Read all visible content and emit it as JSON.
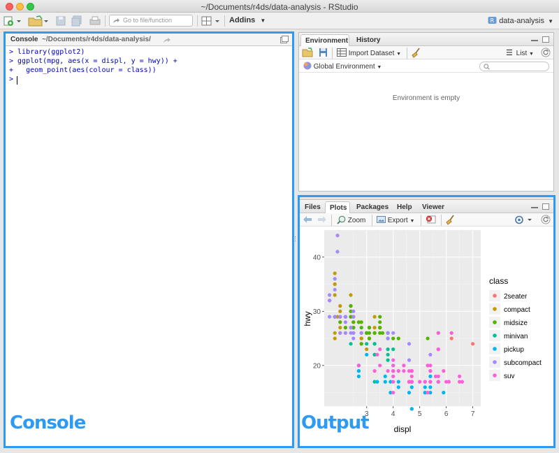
{
  "window": {
    "title": "~/Documents/r4ds/data-analysis - RStudio"
  },
  "toolbar": {
    "goto_placeholder": "Go to file/function",
    "addins_label": "Addins",
    "project_label": "data-analysis"
  },
  "console": {
    "tab_label": "Console",
    "path": "~/Documents/r4ds/data-analysis/",
    "lines": [
      "> library(ggplot2)",
      "> ggplot(mpg, aes(x = displ, y = hwy)) +",
      "+   geom_point(aes(colour = class))",
      ">"
    ],
    "overlay_label": "Console"
  },
  "environment": {
    "tabs": [
      "Environment",
      "History"
    ],
    "import_label": "Import Dataset",
    "list_label": "List",
    "scope_label": "Global Environment",
    "empty_text": "Environment is empty"
  },
  "output": {
    "tabs": [
      "Files",
      "Plots",
      "Packages",
      "Help",
      "Viewer"
    ],
    "zoom_label": "Zoom",
    "export_label": "Export",
    "overlay_label": "Output"
  },
  "colors": {
    "accent": "#2f9af2",
    "code": "#0000c0"
  },
  "chart_data": {
    "type": "scatter",
    "xlabel": "displ",
    "ylabel": "hwy",
    "x_ticks": [
      3,
      4,
      5,
      6,
      7
    ],
    "y_ticks": [
      20,
      30,
      40
    ],
    "xlim": [
      1.4,
      7.3
    ],
    "ylim": [
      12.5,
      45
    ],
    "grid": true,
    "legend": {
      "title": "class",
      "position": "right",
      "entries": [
        {
          "name": "2seater",
          "color": "#f8766d"
        },
        {
          "name": "compact",
          "color": "#c49a00"
        },
        {
          "name": "midsize",
          "color": "#53b400"
        },
        {
          "name": "minivan",
          "color": "#00c094"
        },
        {
          "name": "pickup",
          "color": "#00b6eb"
        },
        {
          "name": "subcompact",
          "color": "#a58aff"
        },
        {
          "name": "suv",
          "color": "#fb61d7"
        }
      ]
    },
    "series": [
      {
        "name": "2seater",
        "points": [
          [
            5.7,
            26
          ],
          [
            5.7,
            23
          ],
          [
            6.2,
            26
          ],
          [
            6.2,
            25
          ],
          [
            7.0,
            24
          ]
        ]
      },
      {
        "name": "compact",
        "points": [
          [
            1.8,
            29
          ],
          [
            1.8,
            29
          ],
          [
            2.0,
            31
          ],
          [
            2.0,
            30
          ],
          [
            2.8,
            26
          ],
          [
            2.8,
            26
          ],
          [
            3.1,
            27
          ],
          [
            1.8,
            26
          ],
          [
            1.8,
            25
          ],
          [
            2.0,
            28
          ],
          [
            2.0,
            27
          ],
          [
            2.8,
            25
          ],
          [
            2.8,
            25
          ],
          [
            3.1,
            25
          ],
          [
            3.1,
            25
          ],
          [
            2.2,
            26
          ],
          [
            2.2,
            27
          ],
          [
            2.4,
            30
          ],
          [
            2.4,
            33
          ],
          [
            3.0,
            26
          ],
          [
            3.3,
            27
          ],
          [
            1.8,
            33
          ],
          [
            1.8,
            35
          ],
          [
            1.8,
            37
          ],
          [
            1.8,
            35
          ],
          [
            1.9,
            44
          ],
          [
            2.0,
            29
          ],
          [
            2.0,
            26
          ],
          [
            2.5,
            29
          ],
          [
            2.5,
            29
          ],
          [
            2.8,
            24
          ],
          [
            2.8,
            24
          ],
          [
            1.9,
            29
          ],
          [
            2.0,
            29
          ],
          [
            2.5,
            28
          ],
          [
            2.5,
            28
          ],
          [
            2.0,
            29
          ],
          [
            2.2,
            29
          ],
          [
            2.2,
            29
          ],
          [
            2.7,
            28
          ],
          [
            3.0,
            23
          ],
          [
            2.4,
            31
          ],
          [
            3.3,
            29
          ]
        ]
      },
      {
        "name": "midsize",
        "points": [
          [
            2.4,
            27
          ],
          [
            2.4,
            30
          ],
          [
            3.1,
            26
          ],
          [
            3.5,
            29
          ],
          [
            3.6,
            26
          ],
          [
            2.2,
            29
          ],
          [
            2.2,
            27
          ],
          [
            2.4,
            31
          ],
          [
            2.4,
            31
          ],
          [
            3.0,
            26
          ],
          [
            3.0,
            26
          ],
          [
            3.5,
            28
          ],
          [
            2.5,
            27
          ],
          [
            2.5,
            27
          ],
          [
            3.3,
            26
          ],
          [
            3.8,
            26
          ],
          [
            3.8,
            26
          ],
          [
            3.8,
            26
          ],
          [
            5.3,
            25
          ],
          [
            2.5,
            27
          ],
          [
            2.7,
            28
          ],
          [
            2.8,
            24
          ],
          [
            3.1,
            27
          ],
          [
            4.2,
            25
          ],
          [
            2.8,
            27
          ],
          [
            3.0,
            26
          ],
          [
            2.4,
            29
          ],
          [
            2.4,
            29
          ],
          [
            3.3,
            26
          ],
          [
            3.3,
            26
          ],
          [
            3.5,
            27
          ],
          [
            3.5,
            27
          ],
          [
            2.5,
            27
          ],
          [
            2.5,
            28
          ],
          [
            3.5,
            26
          ],
          [
            1.8,
            29
          ],
          [
            2.0,
            28
          ],
          [
            2.8,
            28
          ],
          [
            3.5,
            27
          ],
          [
            3.1,
            27
          ],
          [
            3.1,
            25
          ],
          [
            3.8,
            25
          ],
          [
            4.0,
            25
          ]
        ]
      },
      {
        "name": "minivan",
        "points": [
          [
            2.4,
            24
          ],
          [
            3.0,
            24
          ],
          [
            3.3,
            22
          ],
          [
            3.3,
            22
          ],
          [
            3.3,
            24
          ],
          [
            3.3,
            24
          ],
          [
            3.3,
            17
          ],
          [
            3.8,
            22
          ],
          [
            3.8,
            21
          ],
          [
            3.8,
            23
          ],
          [
            4.0,
            23
          ]
        ]
      },
      {
        "name": "pickup",
        "points": [
          [
            2.7,
            20
          ],
          [
            2.7,
            20
          ],
          [
            2.7,
            19
          ],
          [
            3.0,
            22
          ],
          [
            3.7,
            17
          ],
          [
            3.7,
            18
          ],
          [
            3.9,
            17
          ],
          [
            3.9,
            15
          ],
          [
            4.7,
            17
          ],
          [
            4.7,
            17
          ],
          [
            4.7,
            16
          ],
          [
            4.7,
            12
          ],
          [
            5.2,
            15
          ],
          [
            5.2,
            16
          ],
          [
            5.7,
            17
          ],
          [
            5.9,
            15
          ],
          [
            4.7,
            17
          ],
          [
            4.7,
            17
          ],
          [
            4.7,
            17
          ],
          [
            4.7,
            12
          ],
          [
            5.2,
            17
          ],
          [
            5.2,
            15
          ],
          [
            5.7,
            17
          ],
          [
            4.2,
            17
          ],
          [
            4.2,
            16
          ],
          [
            4.6,
            15
          ],
          [
            4.6,
            17
          ],
          [
            5.4,
            18
          ],
          [
            5.4,
            16
          ],
          [
            5.4,
            15
          ],
          [
            2.7,
            19
          ],
          [
            2.7,
            18
          ],
          [
            3.4,
            17
          ],
          [
            4.0,
            20
          ]
        ]
      },
      {
        "name": "subcompact",
        "points": [
          [
            3.8,
            26
          ],
          [
            3.8,
            25
          ],
          [
            4.0,
            26
          ],
          [
            4.6,
            24
          ],
          [
            4.6,
            21
          ],
          [
            5.4,
            22
          ],
          [
            2.2,
            28
          ],
          [
            2.2,
            26
          ],
          [
            2.5,
            26
          ],
          [
            2.5,
            25
          ],
          [
            1.8,
            29
          ],
          [
            1.8,
            29
          ],
          [
            1.6,
            33
          ],
          [
            1.6,
            32
          ],
          [
            1.6,
            32
          ],
          [
            1.6,
            29
          ],
          [
            1.6,
            32
          ],
          [
            1.8,
            34
          ],
          [
            1.8,
            36
          ],
          [
            1.8,
            36
          ],
          [
            2.0,
            29
          ],
          [
            2.4,
            26
          ],
          [
            2.4,
            27
          ],
          [
            2.5,
            30
          ],
          [
            2.5,
            26
          ],
          [
            2.5,
            29
          ],
          [
            2.2,
            29
          ],
          [
            2.2,
            29
          ],
          [
            2.2,
            29
          ],
          [
            2.5,
            26
          ],
          [
            1.9,
            44
          ],
          [
            1.9,
            41
          ],
          [
            2.0,
            29
          ],
          [
            2.0,
            26
          ],
          [
            2.8,
            26
          ]
        ]
      },
      {
        "name": "suv",
        "points": [
          [
            5.3,
            20
          ],
          [
            5.3,
            15
          ],
          [
            5.3,
            20
          ],
          [
            5.7,
            17
          ],
          [
            6.0,
            17
          ],
          [
            5.7,
            26
          ],
          [
            5.7,
            23
          ],
          [
            6.2,
            26
          ],
          [
            6.5,
            17
          ],
          [
            4.0,
            19
          ],
          [
            4.0,
            19
          ],
          [
            4.0,
            15
          ],
          [
            4.6,
            17
          ],
          [
            5.0,
            17
          ],
          [
            3.8,
            19
          ],
          [
            4.7,
            19
          ],
          [
            4.7,
            17
          ],
          [
            5.2,
            17
          ],
          [
            5.9,
            19
          ],
          [
            4.7,
            17
          ],
          [
            4.2,
            19
          ],
          [
            4.6,
            19
          ],
          [
            5.4,
            17
          ],
          [
            6.1,
            17
          ],
          [
            6.6,
            17
          ],
          [
            4.7,
            19
          ],
          [
            4.7,
            19
          ],
          [
            5.7,
            18
          ],
          [
            4.6,
            17
          ],
          [
            5.4,
            20
          ],
          [
            5.4,
            17
          ],
          [
            5.4,
            17
          ],
          [
            4.0,
            19
          ],
          [
            4.0,
            19
          ],
          [
            4.6,
            17
          ],
          [
            5.0,
            17
          ],
          [
            4.2,
            19
          ],
          [
            4.4,
            19
          ],
          [
            4.7,
            17
          ],
          [
            3.3,
            19
          ],
          [
            3.4,
            22
          ],
          [
            4.0,
            21
          ],
          [
            4.7,
            19
          ],
          [
            6.5,
            18
          ],
          [
            5.4,
            19
          ],
          [
            5.4,
            19
          ],
          [
            4.4,
            20
          ],
          [
            4.4,
            20
          ],
          [
            3.5,
            20
          ],
          [
            3.5,
            23
          ],
          [
            4.0,
            17
          ],
          [
            4.7,
            17
          ],
          [
            4.7,
            18
          ],
          [
            5.6,
            18
          ],
          [
            2.7,
            20
          ],
          [
            2.7,
            20
          ],
          [
            4.0,
            20
          ],
          [
            4.0,
            18
          ]
        ]
      }
    ]
  }
}
